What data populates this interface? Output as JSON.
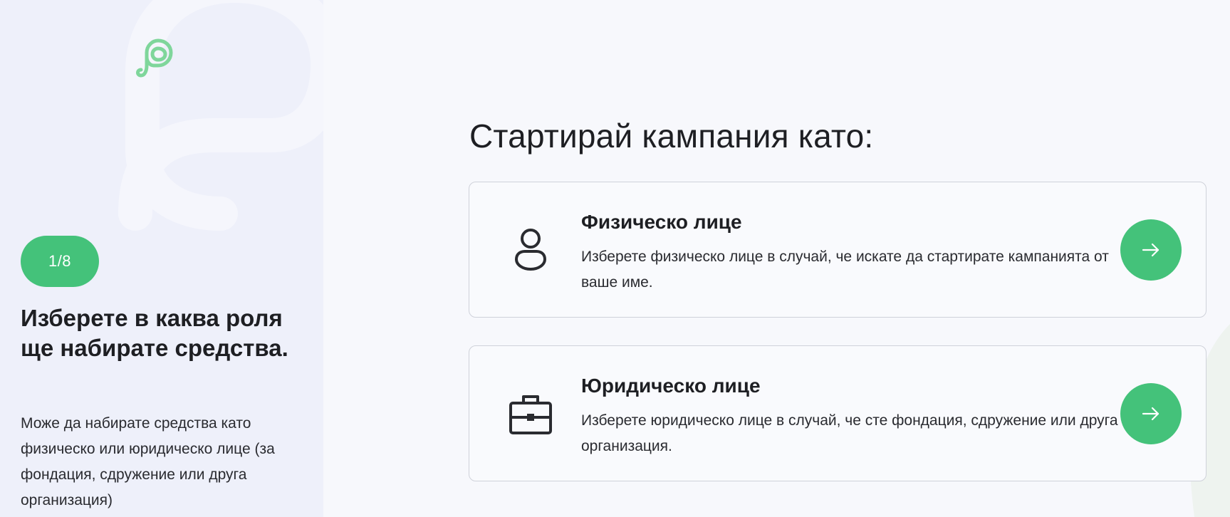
{
  "sidebar": {
    "step": "1/8",
    "title": "Изберете в каква роля ще набирате средства.",
    "description": "Може да набирате средства като физическо или юридическо лице (за фондация, сдружение или друга организация)",
    "logo_icon": "brand-logo-icon"
  },
  "main": {
    "title": "Стартирай кампания като:",
    "options": [
      {
        "icon": "person-icon",
        "title": "Физическо лице",
        "description": "Изберете физическо лице в случай, че искате да стартирате кампанията от ваше име.",
        "action_icon": "arrow-right-icon"
      },
      {
        "icon": "briefcase-icon",
        "title": "Юридическо лице",
        "description": "Изберете юридическо лице в случай, че сте фондация, сдружение или друга организация.",
        "action_icon": "arrow-right-icon"
      }
    ]
  },
  "colors": {
    "accent": "#44c27a",
    "sidebar_bg": "#eef0fa",
    "page_bg": "#f7f8fc",
    "card_border": "#cfd2da",
    "text": "#1e1f23"
  }
}
